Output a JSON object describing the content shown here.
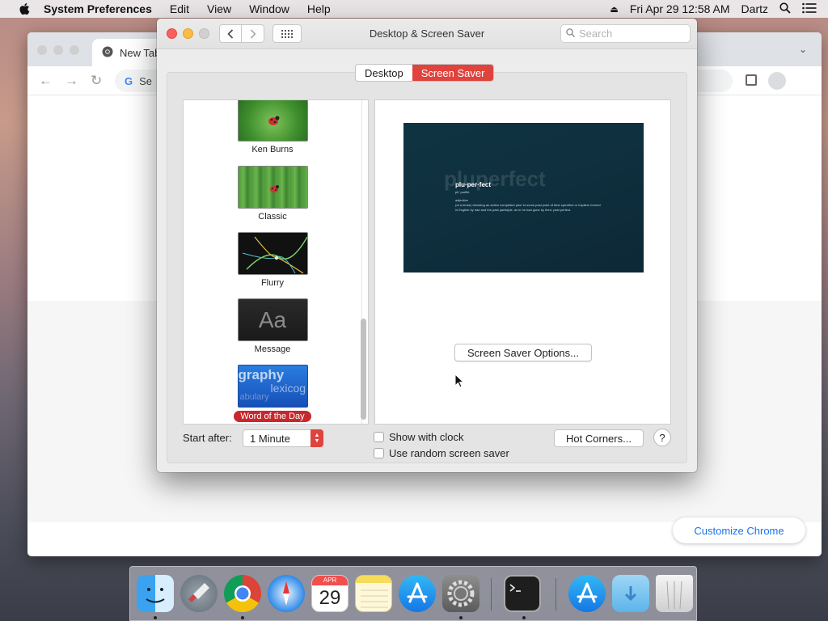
{
  "menubar": {
    "app_name": "System Preferences",
    "menus": [
      "Edit",
      "View",
      "Window",
      "Help"
    ],
    "clock": "Fri Apr 29  12:58 AM",
    "user": "Dartz"
  },
  "chrome": {
    "tab_title": "New Tab",
    "omnibox_text": "Se",
    "customize_label": "Customize Chrome"
  },
  "prefs": {
    "title": "Desktop & Screen Saver",
    "search_placeholder": "Search",
    "tabs": [
      {
        "label": "Desktop",
        "active": false
      },
      {
        "label": "Screen Saver",
        "active": true
      }
    ],
    "savers": [
      {
        "name": "Ken Burns",
        "thumb": "ladybug-green"
      },
      {
        "name": "Classic",
        "thumb": "ladybug-grass"
      },
      {
        "name": "Flurry",
        "thumb": "flurry"
      },
      {
        "name": "Message",
        "thumb": "message",
        "thumb_text": "Aa"
      },
      {
        "name": "Word of the Day",
        "thumb": "word",
        "selected": true,
        "thumb_words": [
          "graphy",
          "lexicog",
          "abulary"
        ]
      }
    ],
    "preview": {
      "ghost_text": "pluperfect",
      "word": "plu·per·fect",
      "pronunciation": "pliːˈpərfikt",
      "part_of_speech": "adjective",
      "definition": "(of a tense) denoting an action completed prior to some past point of time specified or implied; formed in English by had and the past participle, as in he had gone by then; past perfect."
    },
    "options_button": "Screen Saver Options...",
    "start_after_label": "Start after:",
    "start_after_value": "1 Minute",
    "show_clock_label": "Show with clock",
    "show_clock_checked": false,
    "random_label": "Use random screen saver",
    "random_checked": false,
    "hot_corners_label": "Hot Corners...",
    "help_label": "?"
  },
  "dock": {
    "calendar_month": "APR",
    "calendar_day": "29",
    "apps": [
      "finder",
      "launchpad",
      "chrome",
      "safari",
      "calendar",
      "notes",
      "app-store",
      "system-preferences",
      "terminal",
      "app-store-downloads",
      "downloads",
      "trash"
    ]
  }
}
